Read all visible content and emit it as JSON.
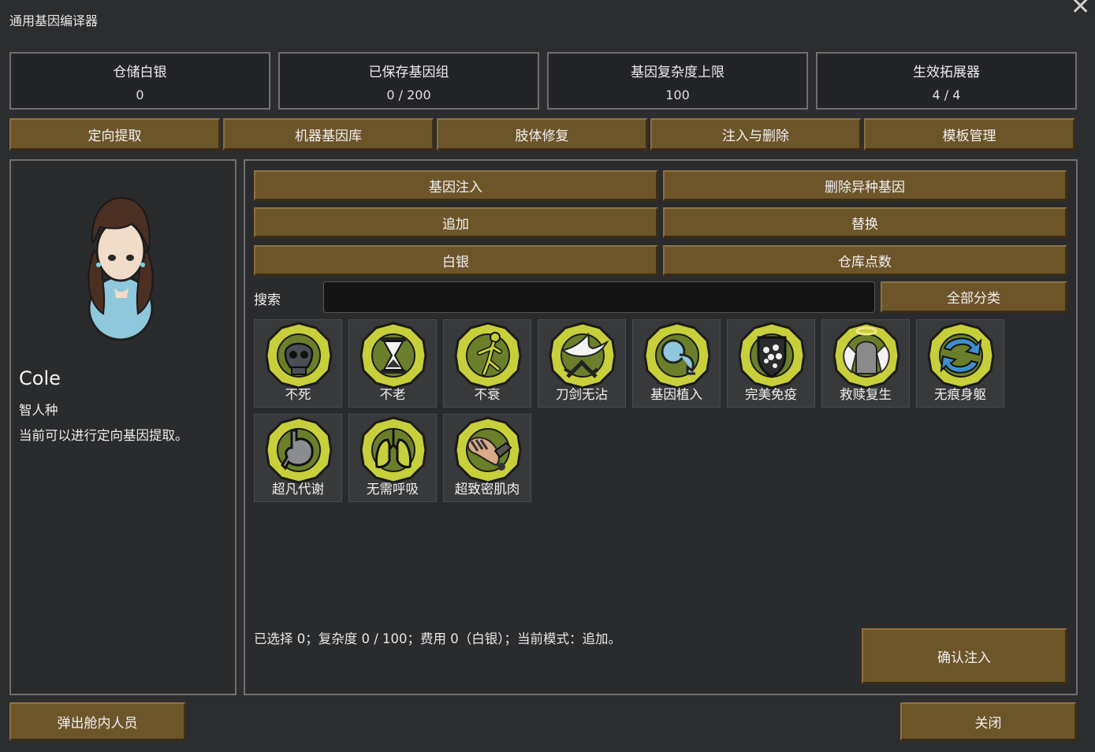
{
  "window": {
    "title": "通用基因编译器",
    "close_glyph": "✕"
  },
  "stats": [
    {
      "label": "仓储白银",
      "value": "0"
    },
    {
      "label": "已保存基因组",
      "value": "0 / 200"
    },
    {
      "label": "基因复杂度上限",
      "value": "100"
    },
    {
      "label": "生效拓展器",
      "value": "4 / 4"
    }
  ],
  "main_tabs": [
    "定向提取",
    "机器基因库",
    "肢体修复",
    "注入与删除",
    "模板管理"
  ],
  "pawn": {
    "name": "Cole",
    "race": "智人种",
    "status": "当前可以进行定向基因提取。"
  },
  "actions": {
    "inject": "基因注入",
    "remove_xenogenes": "删除异种基因",
    "append": "追加",
    "replace": "替换",
    "silver": "白银",
    "storage_points": "仓库点数"
  },
  "search": {
    "label": "搜索",
    "value": "",
    "category": "全部分类"
  },
  "genes": [
    {
      "label": "不死",
      "icon": "skull-icon"
    },
    {
      "label": "不老",
      "icon": "hourglass-icon"
    },
    {
      "label": "不衰",
      "icon": "leaping-figure-icon"
    },
    {
      "label": "刀剑无沾",
      "icon": "dove-swords-icon"
    },
    {
      "label": "基因植入",
      "icon": "capsule-arrow-icon"
    },
    {
      "label": "完美免疫",
      "icon": "shield-icon"
    },
    {
      "label": "救赎复生",
      "icon": "halo-tombstone-icon"
    },
    {
      "label": "无痕身躯",
      "icon": "cycle-arrows-icon"
    },
    {
      "label": "超凡代谢",
      "icon": "stomach-icon"
    },
    {
      "label": "无需呼吸",
      "icon": "lungs-icon"
    },
    {
      "label": "超致密肌肉",
      "icon": "muscle-arm-icon"
    }
  ],
  "footer": {
    "summary": "已选择 0；复杂度 0 / 100；费用 0（白银）；当前模式：追加。",
    "confirm": "确认注入",
    "eject": "弹出舱内人员",
    "close": "关闭"
  },
  "colors": {
    "button_brown": "#6d552a",
    "gene_hex_yellow": "#c7cf3a",
    "background": "#2c2d2f"
  }
}
